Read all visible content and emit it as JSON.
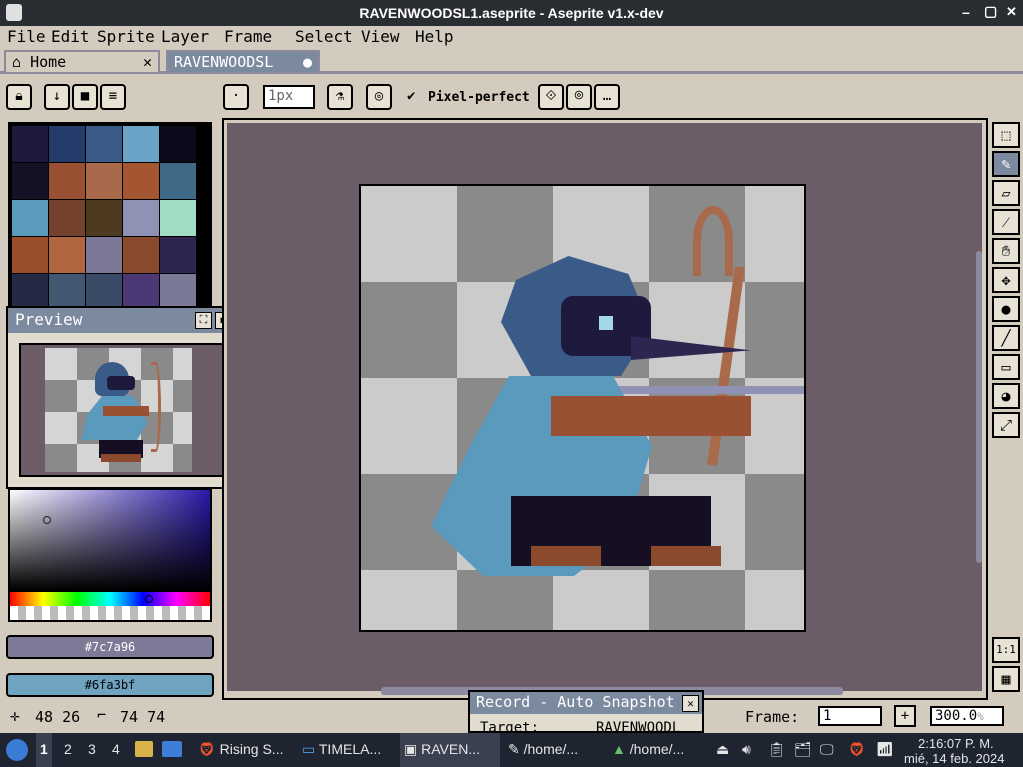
{
  "window": {
    "title": "RAVENWOODSL1.aseprite - Aseprite v1.x-dev",
    "controls": [
      "–",
      "▢",
      "✕"
    ]
  },
  "menu": [
    "File",
    "Edit",
    "Sprite",
    "Layer",
    "Frame",
    "Select",
    "View",
    "Help"
  ],
  "tabs": [
    {
      "label": "Home",
      "active": false
    },
    {
      "label": "RAVENWOODSL",
      "active": true
    }
  ],
  "toolbar": {
    "brush_size": "1px",
    "pixel_perfect_label": "Pixel-perfect",
    "pixel_perfect_checked": true
  },
  "palette": {
    "colors": [
      "#1d1a3d",
      "#253c6b",
      "#3a5a88",
      "#6aa3c5",
      "#0c0a1a",
      "#161226",
      "#9a5033",
      "#a96a4c",
      "#a3562f",
      "#3f6a86",
      "#5a9abd",
      "#73412c",
      "#4d3a21",
      "#8f91b5",
      "#9fdcc2",
      "#9a4e2c",
      "#b06641",
      "#7c7896",
      "#8b4a2e",
      "#2e2550",
      "#252a44",
      "#425872",
      "#3b4a67",
      "#4c3874",
      "#7b7a96"
    ]
  },
  "preview": {
    "title": "Preview"
  },
  "colors": {
    "foreground_hex": "#7c7a96",
    "background_hex": "#6fa3bf"
  },
  "status": {
    "cursor_pos": "48 26",
    "selection_size": "74 74",
    "frame_label": "Frame:",
    "frame_value": "1",
    "zoom": "300.0"
  },
  "record_panel": {
    "title": "Record - Auto Snapshot",
    "target_label": "Target:",
    "target_value": "RAVENWOODL"
  },
  "taskbar": {
    "workspaces": [
      "1",
      "2",
      "3",
      "4"
    ],
    "apps": [
      {
        "label": "Rising S...",
        "icon": "browser-icon"
      },
      {
        "label": "TIMELA...",
        "icon": "folder-icon"
      },
      {
        "label": "RAVEN...",
        "icon": "aseprite-icon"
      },
      {
        "label": "/home/...",
        "icon": "editor-icon"
      },
      {
        "label": "/home/...",
        "icon": "image-viewer-icon"
      }
    ],
    "clock_time": "2:16:07 P. M.",
    "clock_date": "mié, 14 feb. 2024"
  }
}
